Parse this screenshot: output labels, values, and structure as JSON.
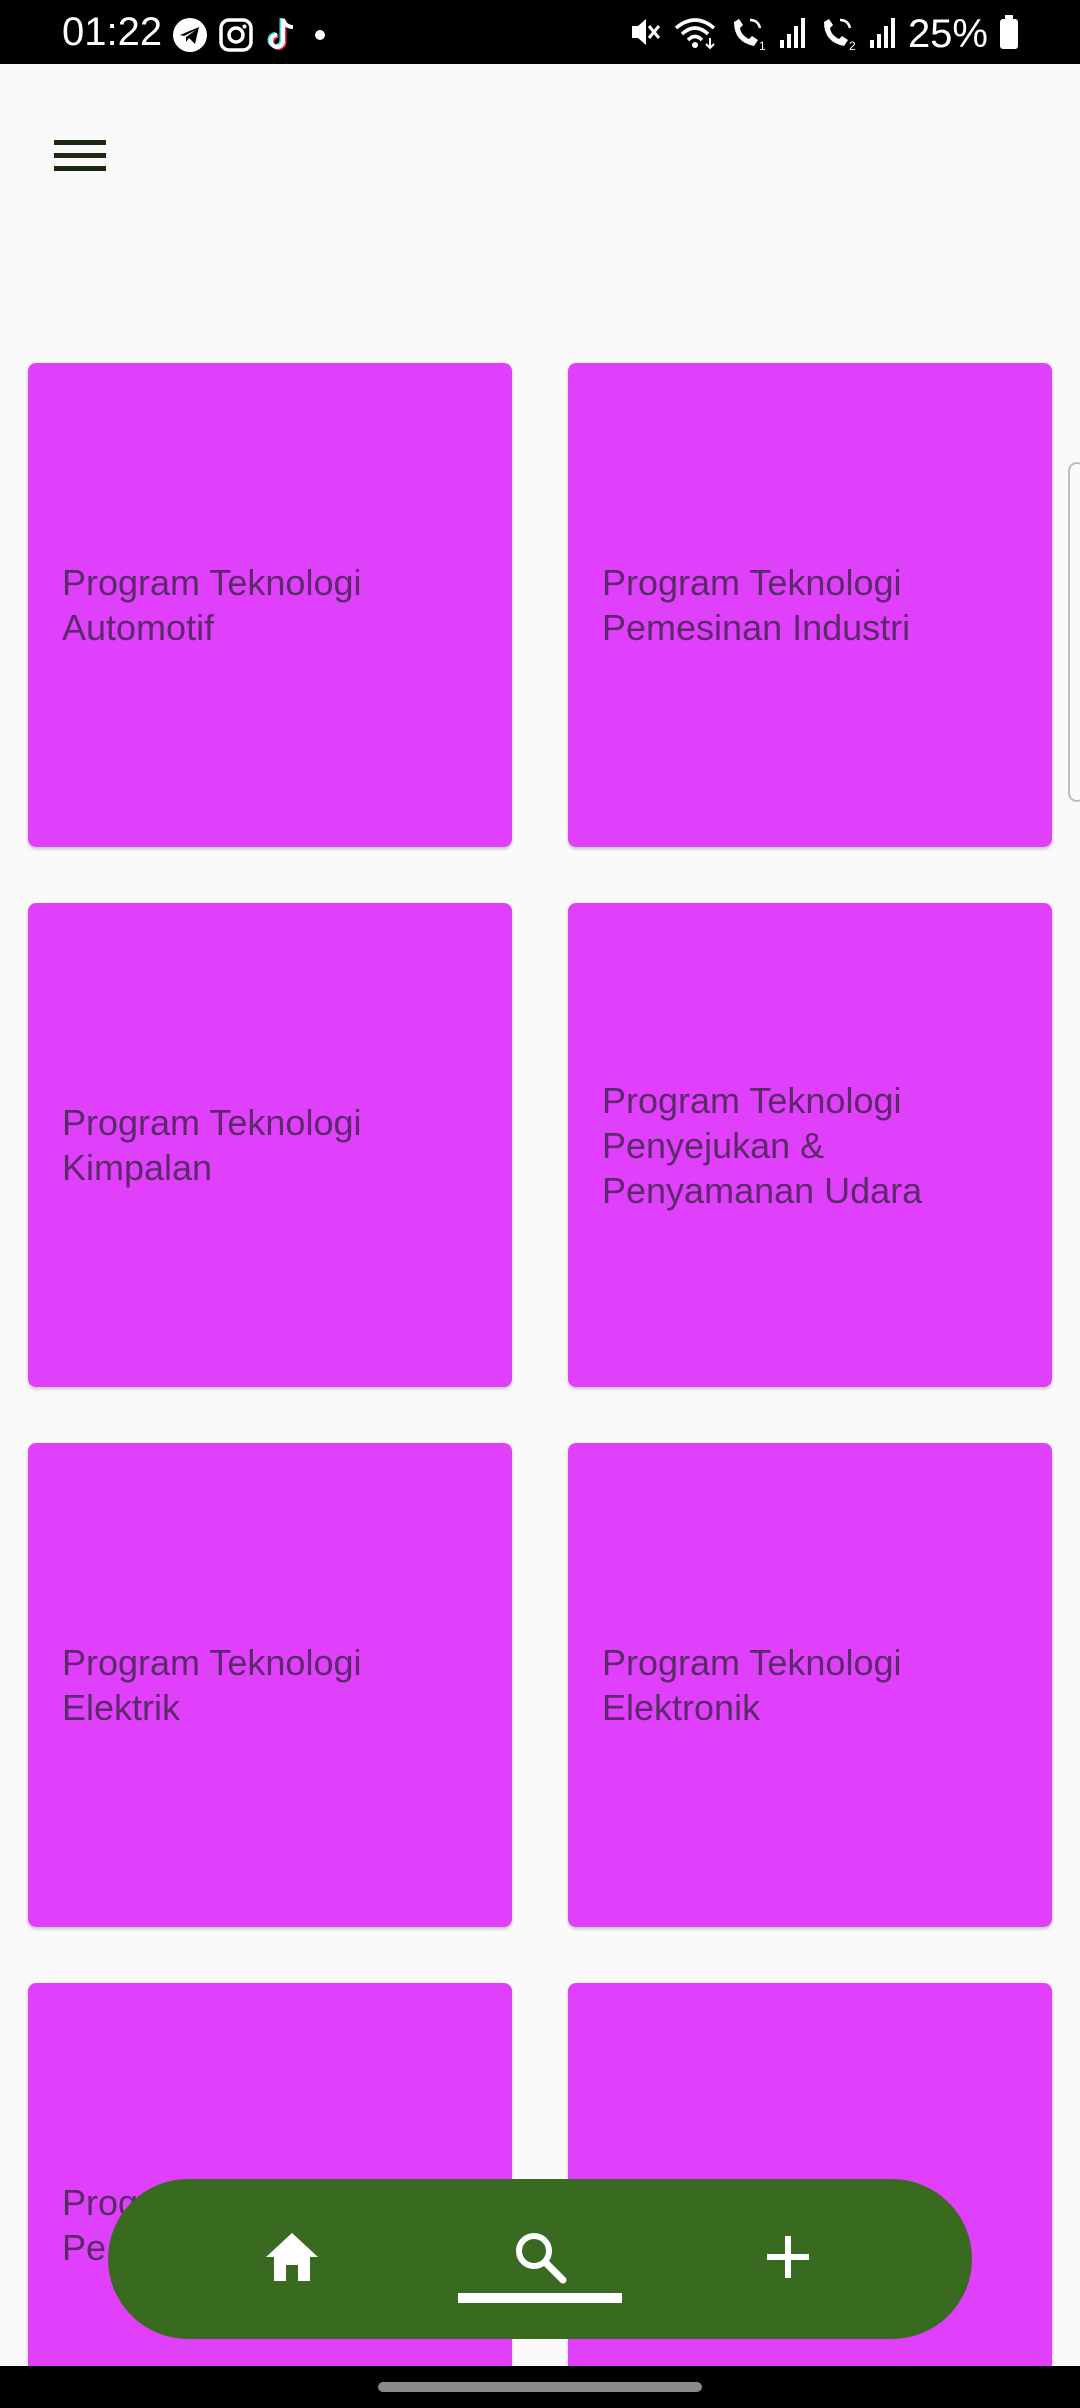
{
  "status_bar": {
    "time": "01:22",
    "battery": "25%",
    "left_icons": [
      "telegram-icon",
      "instagram-icon",
      "tiktok-icon",
      "dot-icon"
    ],
    "right_icons": [
      "mute-icon",
      "wifi-icon",
      "wifi-call-1-icon",
      "signal-1-icon",
      "wifi-call-2-icon",
      "signal-2-icon",
      "battery-icon"
    ]
  },
  "toolbar": {
    "menu_icon": "hamburger-menu-icon"
  },
  "programs": [
    {
      "label": "Program Teknologi\nAutomotif"
    },
    {
      "label": "Program Teknologi\nPemesinan Industri"
    },
    {
      "label": "Program Teknologi\nKimpalan"
    },
    {
      "label": "Program Teknologi\nPenyejukan &\nPenyamanan Udara"
    },
    {
      "label": "Program Teknologi\nElektrik"
    },
    {
      "label": "Program Teknologi\nElektronik"
    },
    {
      "label": "Program Teknologi\nPe"
    },
    {
      "label": ""
    }
  ],
  "bottom_nav": {
    "items": [
      {
        "name": "home",
        "icon": "home-icon"
      },
      {
        "name": "search",
        "icon": "search-icon",
        "selected": true
      },
      {
        "name": "add",
        "icon": "plus-icon"
      }
    ],
    "background": "#386a20"
  },
  "colors": {
    "card": "#e040fb",
    "card_text": "#5c2a6a",
    "background": "#fafafa",
    "nav": "#386a20"
  }
}
